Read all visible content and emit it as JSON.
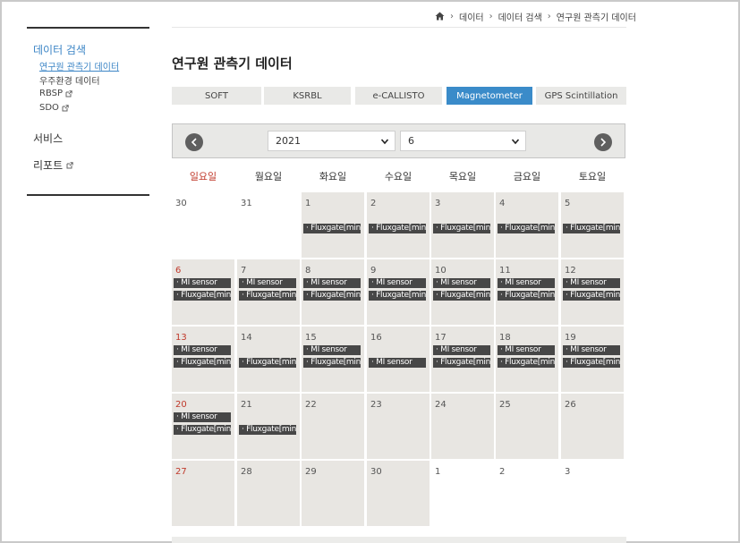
{
  "sidebar": {
    "heading": "데이터 검색",
    "subitems": [
      "연구원 관측기 데이터",
      "우주환경 데이터",
      "RBSP",
      "SDO"
    ],
    "main_items": [
      "서비스",
      "리포트"
    ]
  },
  "breadcrumb": [
    "데이터",
    "데이터 검색",
    "연구원 관측기 데이터"
  ],
  "page_title": "연구원 관측기 데이터",
  "tabs": [
    "SOFT",
    "KSRBL",
    "e-CALLISTO",
    "Magnetometer",
    "GPS Scintillation"
  ],
  "active_tab": "Magnetometer",
  "month_nav": {
    "year": "2021",
    "month": "6"
  },
  "weekdays": [
    "일요일",
    "월요일",
    "화요일",
    "수요일",
    "목요일",
    "금요일",
    "토요일"
  ],
  "events": {
    "mi": "· MI sensor",
    "flux": "· Fluxgate[min]"
  },
  "calendar": [
    [
      {
        "day": "30",
        "shade": false,
        "events": []
      },
      {
        "day": "31",
        "shade": false,
        "events": []
      },
      {
        "day": "1",
        "shade": true,
        "events": [
          "flux"
        ]
      },
      {
        "day": "2",
        "shade": true,
        "events": [
          "flux"
        ]
      },
      {
        "day": "3",
        "shade": true,
        "events": [
          "flux"
        ]
      },
      {
        "day": "4",
        "shade": true,
        "events": [
          "flux"
        ]
      },
      {
        "day": "5",
        "shade": true,
        "events": [
          "flux"
        ]
      }
    ],
    [
      {
        "day": "6",
        "shade": true,
        "events": [
          "mi",
          "flux"
        ]
      },
      {
        "day": "7",
        "shade": true,
        "events": [
          "mi",
          "flux"
        ]
      },
      {
        "day": "8",
        "shade": true,
        "events": [
          "mi",
          "flux"
        ]
      },
      {
        "day": "9",
        "shade": true,
        "events": [
          "mi",
          "flux"
        ]
      },
      {
        "day": "10",
        "shade": true,
        "events": [
          "mi",
          "flux"
        ]
      },
      {
        "day": "11",
        "shade": true,
        "events": [
          "mi",
          "flux"
        ]
      },
      {
        "day": "12",
        "shade": true,
        "events": [
          "mi",
          "flux"
        ]
      }
    ],
    [
      {
        "day": "13",
        "shade": true,
        "events": [
          "mi",
          "flux"
        ]
      },
      {
        "day": "14",
        "shade": true,
        "events": [
          "flux"
        ]
      },
      {
        "day": "15",
        "shade": true,
        "events": [
          "mi",
          "flux"
        ]
      },
      {
        "day": "16",
        "shade": true,
        "events": [
          "mi"
        ]
      },
      {
        "day": "17",
        "shade": true,
        "events": [
          "mi",
          "flux"
        ]
      },
      {
        "day": "18",
        "shade": true,
        "events": [
          "mi",
          "flux"
        ]
      },
      {
        "day": "19",
        "shade": true,
        "events": [
          "mi",
          "flux"
        ]
      }
    ],
    [
      {
        "day": "20",
        "shade": true,
        "events": [
          "mi",
          "flux"
        ]
      },
      {
        "day": "21",
        "shade": true,
        "events": [
          "flux"
        ]
      },
      {
        "day": "22",
        "shade": true,
        "events": []
      },
      {
        "day": "23",
        "shade": true,
        "events": []
      },
      {
        "day": "24",
        "shade": true,
        "events": []
      },
      {
        "day": "25",
        "shade": true,
        "events": []
      },
      {
        "day": "26",
        "shade": true,
        "events": []
      }
    ],
    [
      {
        "day": "27",
        "shade": true,
        "events": []
      },
      {
        "day": "28",
        "shade": true,
        "events": []
      },
      {
        "day": "29",
        "shade": true,
        "events": []
      },
      {
        "day": "30",
        "shade": true,
        "events": []
      },
      {
        "day": "1",
        "shade": false,
        "events": []
      },
      {
        "day": "2",
        "shade": false,
        "events": []
      },
      {
        "day": "3",
        "shade": false,
        "events": []
      }
    ]
  ],
  "icons": {
    "home": "home-icon",
    "external": "external-link-icon",
    "prev": "chevron-left-icon",
    "next": "chevron-right-icon"
  },
  "colors": {
    "accent": "#3a8bc9",
    "event_bg": "#474747",
    "cell_bg": "#e8e6e2",
    "sunday": "#c0392b"
  }
}
